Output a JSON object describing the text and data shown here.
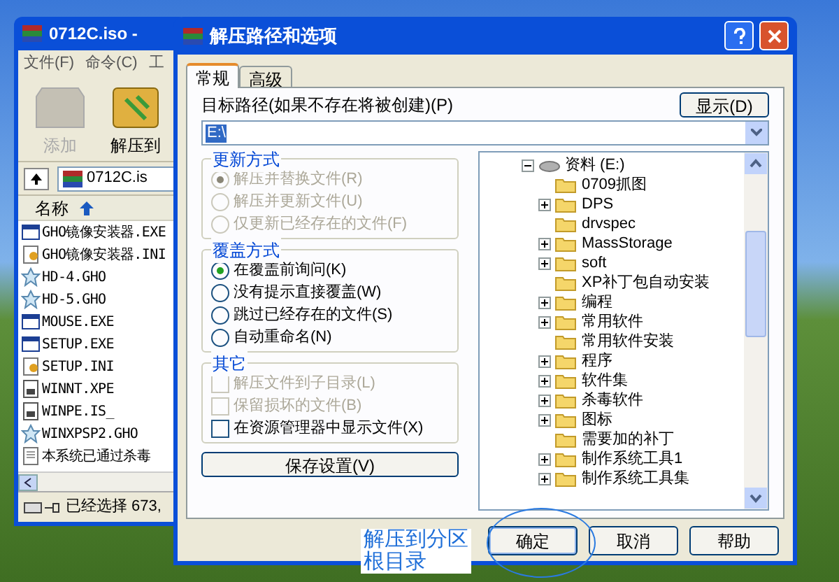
{
  "archive_window": {
    "title": "0712C.iso -",
    "menu": [
      "文件(F)",
      "命令(C)",
      "工"
    ],
    "toolbar": [
      {
        "label": "添加",
        "disabled": true
      },
      {
        "label": "解压到",
        "disabled": false
      }
    ],
    "path": "0712C.is",
    "column": "名称",
    "files": [
      {
        "name": "GHO镜像安装器.EXE",
        "kind": "exe"
      },
      {
        "name": "GHO镜像安装器.INI",
        "kind": "ini"
      },
      {
        "name": "HD-4.GHO",
        "kind": "gho"
      },
      {
        "name": "HD-5.GHO",
        "kind": "gho"
      },
      {
        "name": "MOUSE.EXE",
        "kind": "exe"
      },
      {
        "name": "SETUP.EXE",
        "kind": "exe"
      },
      {
        "name": "SETUP.INI",
        "kind": "ini"
      },
      {
        "name": "WINNT.XPE",
        "kind": "doc"
      },
      {
        "name": "WINPE.IS_",
        "kind": "doc"
      },
      {
        "name": "WINXPSP2.GHO",
        "kind": "gho"
      },
      {
        "name": "本系统已通过杀毒",
        "kind": "txt"
      }
    ],
    "status": "已经选择 673,"
  },
  "dialog": {
    "title": "解压路径和选项",
    "tabs": [
      {
        "label": "常规",
        "selected": true
      },
      {
        "label": "高级",
        "selected": false
      }
    ],
    "path_label": "目标路径(如果不存在将被创建)(P)",
    "path_value": "E:\\",
    "show_button": "显示(D)",
    "groups": [
      {
        "title": "更新方式",
        "kind": "radio",
        "disabled": true,
        "options": [
          {
            "label": "解压并替换文件(R)",
            "selected": true
          },
          {
            "label": "解压并更新文件(U)",
            "selected": false
          },
          {
            "label": "仅更新已经存在的文件(F)",
            "selected": false
          }
        ]
      },
      {
        "title": "覆盖方式",
        "kind": "radio",
        "disabled": false,
        "options": [
          {
            "label": "在覆盖前询问(K)",
            "selected": true
          },
          {
            "label": "没有提示直接覆盖(W)",
            "selected": false
          },
          {
            "label": "跳过已经存在的文件(S)",
            "selected": false
          },
          {
            "label": "自动重命名(N)",
            "selected": false
          }
        ]
      },
      {
        "title": "其它",
        "kind": "check",
        "options": [
          {
            "label": "解压文件到子目录(L)",
            "checked": false,
            "disabled": true
          },
          {
            "label": "保留损坏的文件(B)",
            "checked": false,
            "disabled": true
          },
          {
            "label": "在资源管理器中显示文件(X)",
            "checked": false,
            "disabled": false
          }
        ]
      }
    ],
    "save_button": "保存设置(V)",
    "tree": {
      "label": "资料 (E:)",
      "expanded": true,
      "children": [
        {
          "label": "0709抓图",
          "has_children": false
        },
        {
          "label": "DPS",
          "has_children": true
        },
        {
          "label": "drvspec",
          "has_children": false
        },
        {
          "label": "MassStorage",
          "has_children": true
        },
        {
          "label": "soft",
          "has_children": true
        },
        {
          "label": "XP补丁包自动安装",
          "has_children": false
        },
        {
          "label": "编程",
          "has_children": true
        },
        {
          "label": "常用软件",
          "has_children": true
        },
        {
          "label": "常用软件安装",
          "has_children": false
        },
        {
          "label": "程序",
          "has_children": true
        },
        {
          "label": "软件集",
          "has_children": true
        },
        {
          "label": "杀毒软件",
          "has_children": true
        },
        {
          "label": "图标",
          "has_children": true
        },
        {
          "label": "需要加的补丁",
          "has_children": false
        },
        {
          "label": "制作系统工具1",
          "has_children": true
        },
        {
          "label": "制作系统工具集",
          "has_children": true
        }
      ]
    },
    "buttons": [
      "确定",
      "取消",
      "帮助"
    ]
  },
  "annotation": {
    "lines": [
      "解压到分区",
      "根目录"
    ]
  }
}
